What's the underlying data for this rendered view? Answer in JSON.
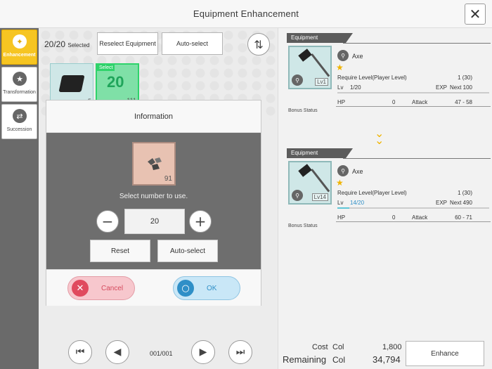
{
  "window": {
    "title": "Equipment Enhancement"
  },
  "sidebar": {
    "items": [
      {
        "label": "Enhancement",
        "icon": "enhance-icon",
        "active": true
      },
      {
        "label": "Transformation",
        "icon": "transform-icon",
        "active": false
      },
      {
        "label": "Succession",
        "icon": "succession-icon",
        "active": false
      }
    ]
  },
  "toolbar": {
    "selected": "20/20",
    "selected_label": "Selected",
    "reselect_label": "Reselect Equipment",
    "autoselect_label": "Auto-select"
  },
  "inventory": [
    {
      "count": "5",
      "selected": false
    },
    {
      "count": "111",
      "selected": true,
      "tag": "Select",
      "glyph": "20"
    }
  ],
  "dialog": {
    "title": "Information",
    "material_count": "91",
    "hint": "Select number to use.",
    "quantity": "20",
    "minus": "−",
    "plus": "+",
    "reset_label": "Reset",
    "autoselect_label": "Auto-select",
    "cancel_label": "Cancel",
    "ok_label": "OK"
  },
  "pagination": {
    "page": "001/001"
  },
  "equipment_before": {
    "tag": "Equipment",
    "name": "Axe",
    "level_badge": "Lv1",
    "require_label": "Require Level(Player Level)",
    "require_value": "1 (30)",
    "lv_label": "Lv",
    "lv_value": "1/20",
    "exp_label": "EXP",
    "next_label": "Next 100",
    "hp_label": "HP",
    "hp_value": "0",
    "attack_label": "Attack",
    "attack_value": "47 - 58",
    "bonus_label": "Bonus Status",
    "xp_fraction": 0
  },
  "equipment_after": {
    "tag": "Equipment",
    "name": "Axe",
    "level_badge": "Lv14",
    "require_label": "Require Level(Player Level)",
    "require_value": "1 (30)",
    "lv_label": "Lv",
    "lv_value": "14/20",
    "exp_label": "EXP",
    "next_label": "Next 490",
    "hp_label": "HP",
    "hp_value": "0",
    "attack_label": "Attack",
    "attack_value": "60 - 71",
    "bonus_label": "Bonus Status",
    "xp_fraction": 0.08
  },
  "cost": {
    "cost_label": "Cost",
    "remaining_label": "Remaining",
    "currency": "Col",
    "cost_value": "1,800",
    "remaining_value": "34,794",
    "enhance_label": "Enhance"
  },
  "colors": {
    "accent": "#f6c522",
    "cancel": "#e04a5e",
    "ok": "#2f8fc7",
    "select": "#2fd36b"
  }
}
